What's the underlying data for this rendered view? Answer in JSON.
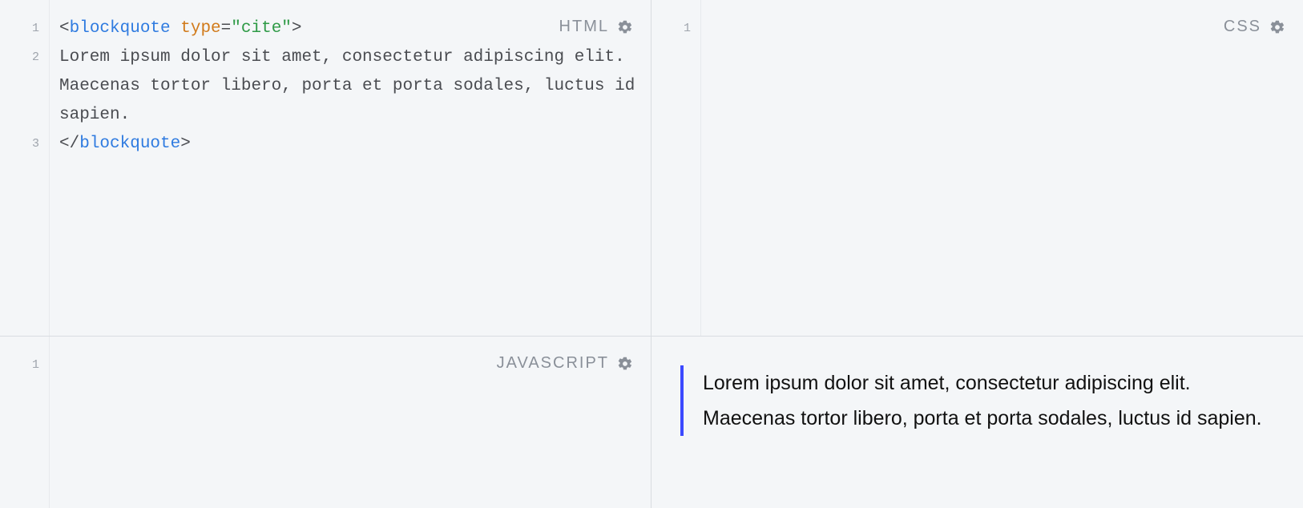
{
  "panels": {
    "html": {
      "label": "HTML"
    },
    "css": {
      "label": "CSS"
    },
    "js": {
      "label": "JAVASCRIPT"
    }
  },
  "code": {
    "html": {
      "line1_tag_open": "blockquote",
      "line1_attr_name": "type",
      "line1_attr_value": "\"cite\"",
      "line2_text": "Lorem ipsum dolor sit amet, consectetur adipiscing elit. Maecenas tortor libero, porta et porta sodales, luctus id sapien.",
      "line3_tag_close": "blockquote"
    }
  },
  "line_numbers": {
    "html": [
      "1",
      "2",
      "3"
    ],
    "css": [
      "1"
    ],
    "js": [
      "1"
    ]
  },
  "output": {
    "blockquote_text": "Lorem ipsum dolor sit amet, consectetur adipiscing elit. Maecenas tortor libero, porta et porta sodales, luctus id sapien."
  }
}
